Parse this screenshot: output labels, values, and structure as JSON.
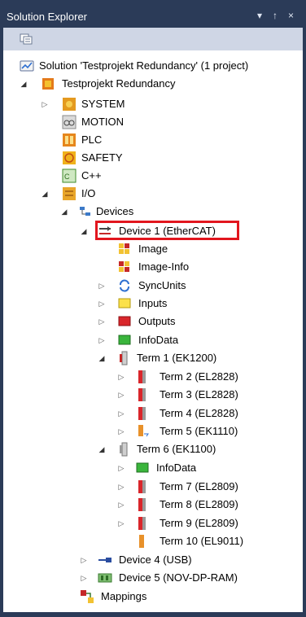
{
  "window": {
    "title": "Solution Explorer",
    "pin_glyph": "↑",
    "dropdown_glyph": "▾",
    "close_glyph": "×"
  },
  "toolbar": {
    "properties_icon": "properties-icon"
  },
  "tree": {
    "solution": "Solution 'Testprojekt Redundancy' (1 project)",
    "project": "Testprojekt Redundancy",
    "system": "SYSTEM",
    "motion": "MOTION",
    "plc": "PLC",
    "safety": "SAFETY",
    "cpp": "C++",
    "io": "I/O",
    "devices": "Devices",
    "device1": "Device 1 (EtherCAT)",
    "image": "Image",
    "image_info": "Image-Info",
    "syncunits": "SyncUnits",
    "inputs": "Inputs",
    "outputs": "Outputs",
    "infodata": "InfoData",
    "term1": "Term 1 (EK1200)",
    "term2": "Term 2 (EL2828)",
    "term3": "Term 3 (EL2828)",
    "term4": "Term 4 (EL2828)",
    "term5": "Term 5 (EK1110)",
    "term6": "Term 6 (EK1100)",
    "term6_infodata": "InfoData",
    "term7": "Term 7 (EL2809)",
    "term8": "Term 8 (EL2809)",
    "term9": "Term 9 (EL2809)",
    "term10": "Term 10 (EL9011)",
    "device4": "Device 4 (USB)",
    "device5": "Device 5 (NOV-DP-RAM)",
    "mappings": "Mappings"
  },
  "colors": {
    "frame": "#2b3b58",
    "toolbar": "#cfd6e5",
    "highlight": "#e2161e"
  }
}
